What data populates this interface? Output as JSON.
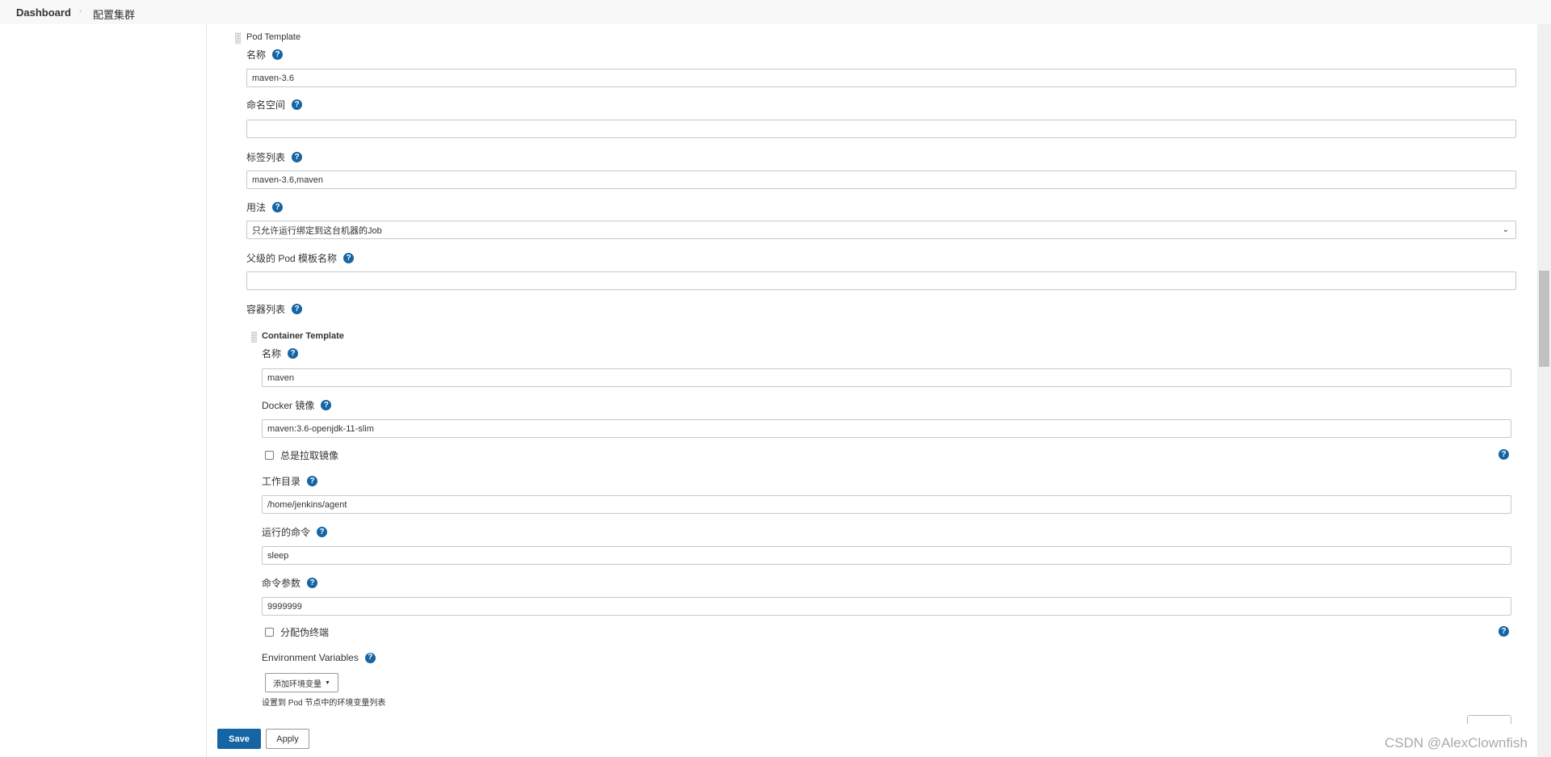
{
  "breadcrumb": {
    "items": [
      "Dashboard",
      "配置集群"
    ],
    "separator_icon": "chevron-right-icon"
  },
  "pod_template": {
    "title": "Pod Template",
    "name": {
      "label": "名称",
      "value": "maven-3.6"
    },
    "namespace": {
      "label": "命名空间",
      "value": ""
    },
    "labels": {
      "label": "标签列表",
      "value": "maven-3.6,maven"
    },
    "usage": {
      "label": "用法",
      "value": "只允许运行绑定到这台机器的Job"
    },
    "parent": {
      "label": "父级的 Pod 模板名称",
      "value": ""
    },
    "containers_label": "容器列表"
  },
  "container_template": {
    "title": "Container Template",
    "name": {
      "label": "名称",
      "value": "maven"
    },
    "image": {
      "label": "Docker 镜像",
      "value": "maven:3.6-openjdk-11-slim"
    },
    "always_pull": {
      "label": "总是拉取镜像",
      "checked": false
    },
    "workdir": {
      "label": "工作目录",
      "value": "/home/jenkins/agent"
    },
    "command": {
      "label": "运行的命令",
      "value": "sleep"
    },
    "args": {
      "label": "命令参数",
      "value": "9999999"
    },
    "tty": {
      "label": "分配伪终端",
      "checked": false
    },
    "env": {
      "label": "Environment Variables",
      "add_button": "添加环境变量",
      "hint": "设置到 Pod 节点中的环境变量列表"
    }
  },
  "actions": {
    "save": "Save",
    "apply": "Apply"
  },
  "watermark": "CSDN @AlexClownfish",
  "colors": {
    "primary": "#1565a5",
    "help": "#1565a5"
  }
}
